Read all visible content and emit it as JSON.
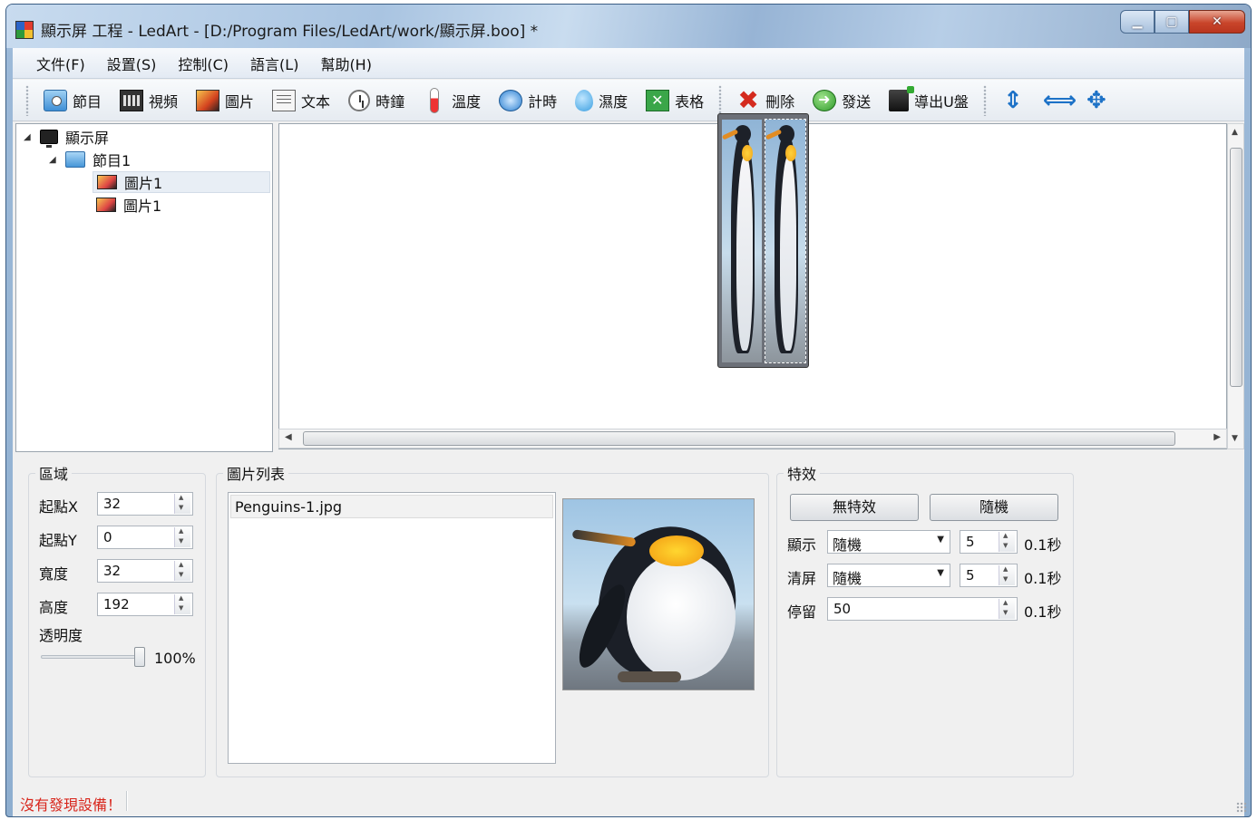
{
  "window": {
    "title": "顯示屏 工程 - LedArt - [D:/Program Files/LedArt/work/顯示屏.boo] *",
    "minimize_icon": "minimize-icon",
    "maximize_icon": "maximize-icon",
    "close_icon": "close-icon"
  },
  "menu": {
    "items": [
      "文件(F)",
      "設置(S)",
      "控制(C)",
      "語言(L)",
      "幫助(H)"
    ]
  },
  "toolbar": {
    "program": "節目",
    "video": "視頻",
    "image": "圖片",
    "text": "文本",
    "clock": "時鐘",
    "temperature": "溫度",
    "timer": "計時",
    "humidity": "濕度",
    "table": "表格",
    "delete": "刪除",
    "send": "發送",
    "export_udisk": "導出U盤"
  },
  "tree": {
    "root": "顯示屏",
    "program": "節目1",
    "image1": "圖片1",
    "image2": "圖片1"
  },
  "region": {
    "title": "區域",
    "start_x_label": "起點X",
    "start_x": "32",
    "start_y_label": "起點Y",
    "start_y": "0",
    "width_label": "寬度",
    "width": "32",
    "height_label": "高度",
    "height": "192",
    "opacity_label": "透明度",
    "opacity": "100%",
    "opacity_value": 1.0
  },
  "image_list": {
    "title": "圖片列表",
    "items": [
      "Penguins-1.jpg"
    ]
  },
  "effects": {
    "title": "特效",
    "no_effect_button": "無特效",
    "random_button": "隨機",
    "show_label": "顯示",
    "show_mode": "隨機",
    "show_value": "5",
    "show_unit": "0.1秒",
    "clear_label": "清屏",
    "clear_mode": "隨機",
    "clear_value": "5",
    "clear_unit": "0.1秒",
    "stay_label": "停留",
    "stay_value": "50",
    "stay_unit": "0.1秒"
  },
  "status": {
    "message": "沒有發現設備！"
  },
  "colors": {
    "status_text": "#d8261c",
    "accent_blue": "#1d72c7",
    "delete_red": "#d42a1e",
    "send_green": "#2e9b2a"
  }
}
